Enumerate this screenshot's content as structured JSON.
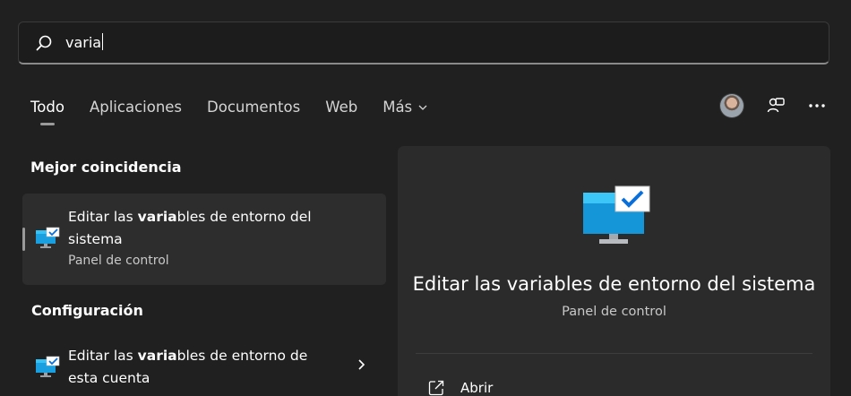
{
  "search": {
    "value": "varia",
    "icon": "search-icon"
  },
  "tabs": [
    {
      "label": "Todo",
      "active": true
    },
    {
      "label": "Aplicaciones",
      "active": false
    },
    {
      "label": "Documentos",
      "active": false
    },
    {
      "label": "Web",
      "active": false
    },
    {
      "label": "Más",
      "active": false,
      "icon": "chevron-down-icon"
    }
  ],
  "header_icons": [
    "avatar",
    "account-switch-icon",
    "more-options-icon"
  ],
  "best_match": {
    "section_title": "Mejor coincidencia",
    "title_prefix": "Editar las ",
    "title_highlight": "varia",
    "title_suffix": "bles de entorno del sistema",
    "subtitle": "Panel de control",
    "icon": "system-properties-icon"
  },
  "configuracion": {
    "section_title": "Configuración",
    "title_prefix": "Editar las ",
    "title_highlight": "varia",
    "title_suffix": "bles de entorno de esta cuenta",
    "icon": "system-properties-icon",
    "chevron": "chevron-right-icon"
  },
  "preview": {
    "title": "Editar las variables de entorno del sistema",
    "subtitle": "Panel de control",
    "icon": "system-properties-icon",
    "actions": [
      {
        "label": "Abrir",
        "icon": "open-external-icon"
      }
    ]
  },
  "colors": {
    "background": "#202020",
    "panel": "#2b2b2b",
    "selected": "#2d2d2d",
    "monitor_blue": "#1aa0e0",
    "check_blue": "#0a6fd8"
  }
}
